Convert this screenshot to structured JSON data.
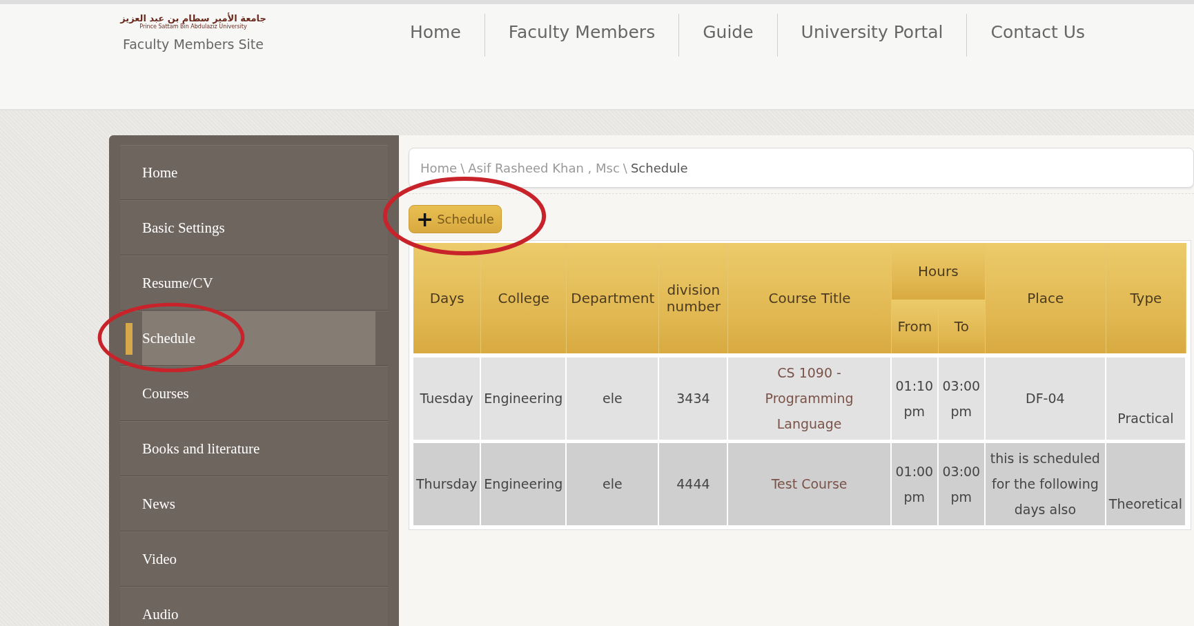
{
  "header": {
    "logo_arabic": "جامعة الأمير سطام بن عبد العزيز",
    "logo_english": "Prince Sattam Bin Abdulaziz University",
    "site_title": "Faculty Members Site"
  },
  "nav": [
    {
      "label": "Home"
    },
    {
      "label": "Faculty Members"
    },
    {
      "label": "Guide"
    },
    {
      "label": "University Portal"
    },
    {
      "label": "Contact Us"
    }
  ],
  "sidebar": {
    "items": [
      {
        "label": "Home",
        "selected": false
      },
      {
        "label": "Basic Settings",
        "selected": false
      },
      {
        "label": "Resume/CV",
        "selected": false
      },
      {
        "label": "Schedule",
        "selected": true
      },
      {
        "label": "Courses",
        "selected": false
      },
      {
        "label": "Books and literature",
        "selected": false
      },
      {
        "label": "News",
        "selected": false
      },
      {
        "label": "Video",
        "selected": false
      },
      {
        "label": "Audio",
        "selected": false
      }
    ]
  },
  "breadcrumb": [
    {
      "label": "Home",
      "current": false
    },
    {
      "label": "Asif Rasheed Khan , Msc",
      "current": false
    },
    {
      "label": "Schedule",
      "current": true
    }
  ],
  "breadcrumb_separator": "\\",
  "add_button": {
    "icon": "+",
    "label": "Schedule"
  },
  "table": {
    "columns": [
      "Days",
      "College",
      "Department",
      "division number",
      "Course Title"
    ],
    "group": {
      "label": "Hours",
      "columns": [
        "From",
        "To"
      ]
    },
    "columns_after": [
      "Place",
      "Type"
    ],
    "rows": [
      {
        "cells": [
          "Tuesday",
          "Engineering",
          "ele",
          "3434",
          "CS 1090 - Programming Language",
          "01:10 pm",
          "03:00 pm",
          "DF-04",
          "Practical"
        ]
      },
      {
        "cells": [
          "Thursday",
          "Engineering",
          "ele",
          "4444",
          "Test Course",
          "01:00 pm",
          "03:00 pm",
          "this is scheduled for the following days also",
          "Theoretical"
        ]
      }
    ]
  },
  "annotations": [
    {
      "kind": "circle"
    },
    {
      "kind": "circle"
    }
  ]
}
